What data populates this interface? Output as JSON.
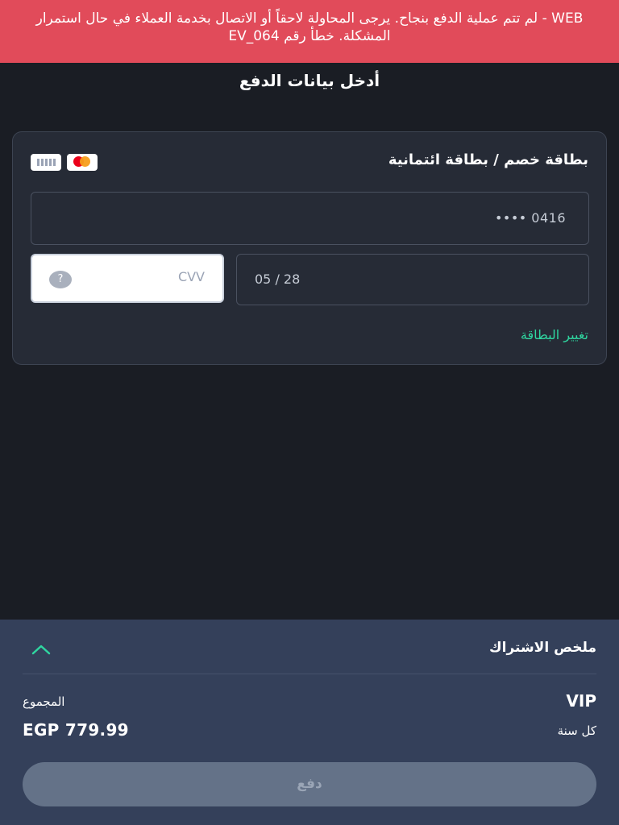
{
  "error_banner": {
    "message": "WEB - لم تتم عملية الدفع بنجاح. يرجى المحاولة لاحقاً أو الاتصال بخدمة العملاء في حال استمرار المشكلة. خطأ رقم EV_064",
    "color": "#e14b5a"
  },
  "page_title": "أدخل بيانات الدفع",
  "card_form": {
    "heading": "بطاقة خصم / بطاقة ائتمانية",
    "logos": [
      "generic-card-icon",
      "mastercard-icon"
    ],
    "card_number": "•••• 0416",
    "expiry": "05 / 28",
    "cvv_placeholder": "CVV",
    "help_icon": "?",
    "change_card_label": "تغيير البطاقة",
    "accent_color": "#2fd6a0"
  },
  "summary": {
    "title": "ملخص الاشتراك",
    "plan_name": "VIP",
    "plan_period": "كل سنة",
    "total_label": "المجموع",
    "total_value": "EGP 779.99",
    "pay_button_label": "دفع",
    "collapse_icon": "chevron-up-icon"
  }
}
